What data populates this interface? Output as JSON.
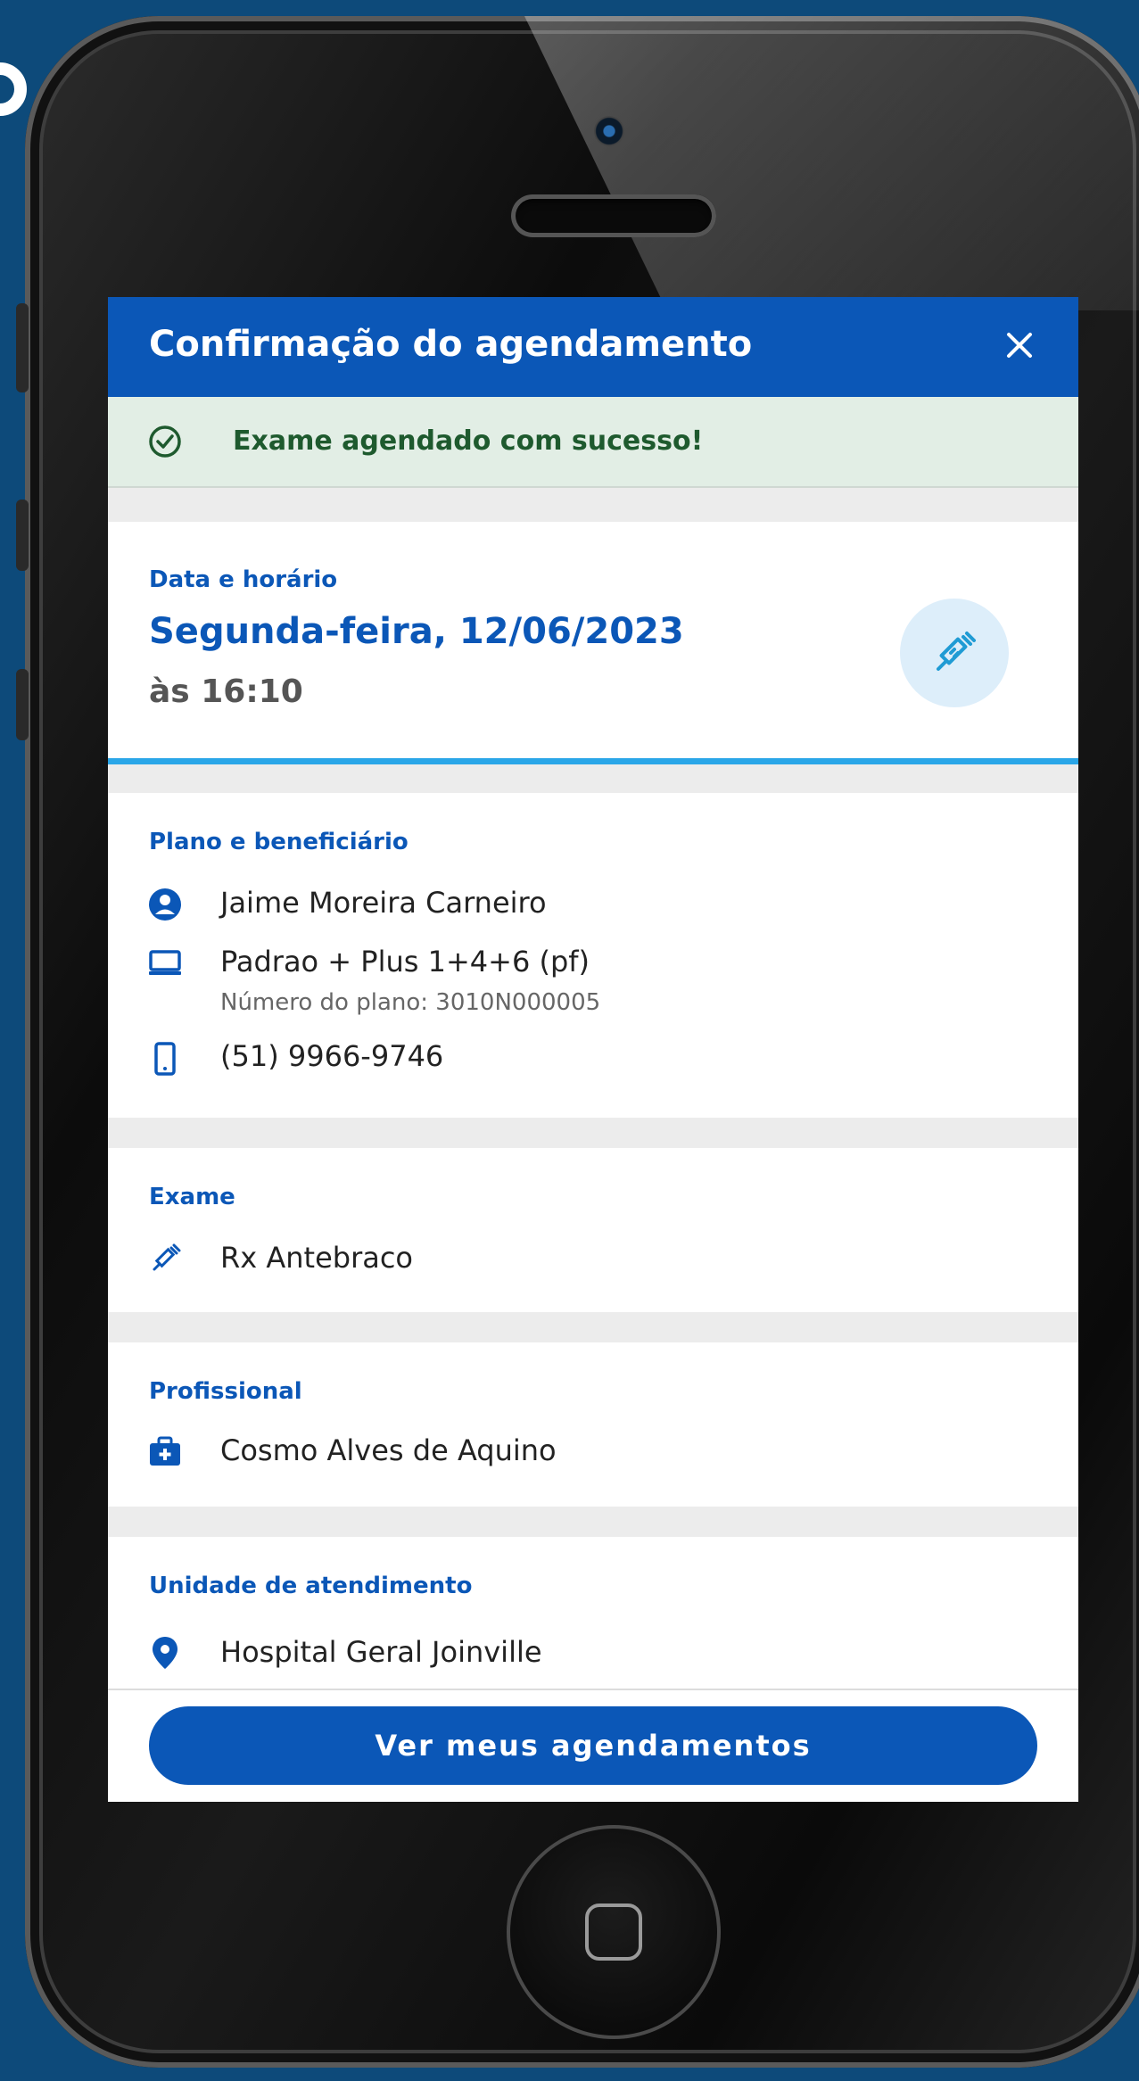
{
  "dialog": {
    "title": "Confirmação do agendamento",
    "close_icon": "close-icon"
  },
  "banner": {
    "icon": "check-circle-icon",
    "message": "Exame agendado com sucesso!"
  },
  "datetime": {
    "label": "Data e horário",
    "date": "Segunda-feira, 12/06/2023",
    "time": "às 16:10",
    "badge_icon": "syringe-icon"
  },
  "plan": {
    "label": "Plano e beneficiário",
    "beneficiary": "Jaime Moreira Carneiro",
    "plan_name": "Padrao + Plus 1+4+6 (pf)",
    "plan_number": "Número do plano: 3010N000005",
    "phone": "(51) 9966-9746"
  },
  "exam": {
    "label": "Exame",
    "name": "Rx Antebraco"
  },
  "professional": {
    "label": "Profissional",
    "name": "Cosmo Alves de Aquino"
  },
  "unit": {
    "label": "Unidade de atendimento",
    "name": "Hospital Geral Joinville"
  },
  "footer": {
    "button_label": "Ver meus agendamentos"
  },
  "colors": {
    "primary": "#0b57b7",
    "success_bg": "#e2eee5",
    "success_text": "#1e5a2e",
    "accent": "#2aa6e8",
    "background": "#0d4a7a"
  }
}
